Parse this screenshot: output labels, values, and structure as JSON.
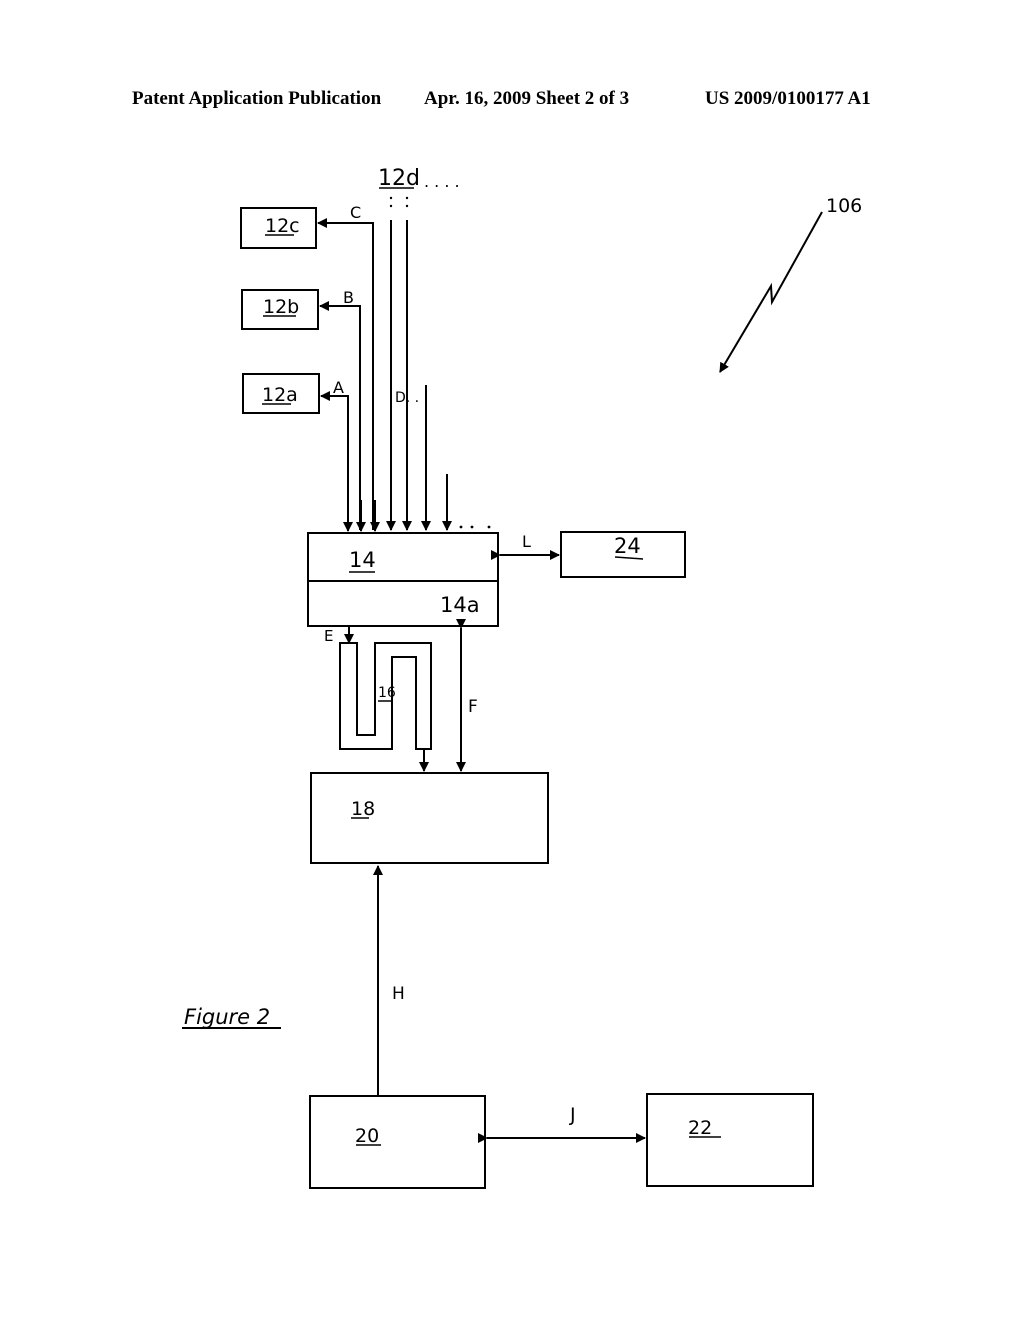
{
  "header": {
    "publication": "Patent Application Publication",
    "date_sheet": "Apr. 16, 2009  Sheet 2 of 3",
    "number": "US 2009/0100177 A1"
  },
  "figure": {
    "caption": "Figure 2",
    "reference": "106",
    "blocks": {
      "b12a": "12a",
      "b12b": "12b",
      "b12c": "12c",
      "b12d": "12d",
      "b14": "14",
      "b14a": "14a",
      "b16": "16",
      "b18": "18",
      "b20": "20",
      "b22": "22",
      "b24": "24"
    },
    "connections": {
      "A": "A",
      "B": "B",
      "C": "C",
      "D": "D. . .",
      "E": "E",
      "F": "F",
      "H": "H",
      "J": "J",
      "L": "L",
      "ellipsis": ". . . ."
    }
  }
}
